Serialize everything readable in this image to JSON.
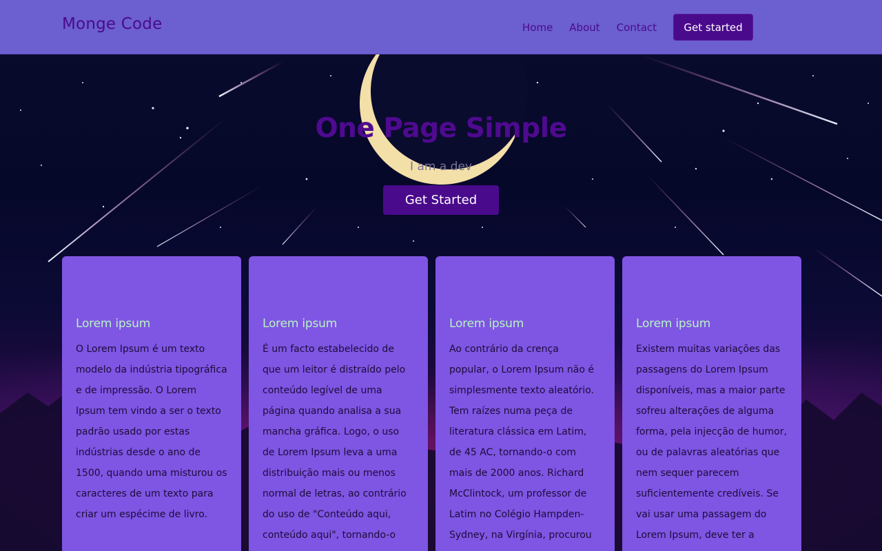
{
  "header": {
    "brand": "Monge Code",
    "nav": {
      "home": "Home",
      "about": "About",
      "contact": "Contact",
      "cta": "Get started"
    }
  },
  "hero": {
    "title": "One Page Simple",
    "subtitle": "I am a dev",
    "button": "Get Started"
  },
  "cards": [
    {
      "title": "Lorem ipsum",
      "text": "O Lorem Ipsum é um texto modelo da indústria tipográfica e de impressão. O Lorem Ipsum tem vindo a ser o texto padrão usado por estas indústrias desde o ano de 1500, quando uma misturou os caracteres de um texto para criar um espécime de livro."
    },
    {
      "title": "Lorem ipsum",
      "text": "É um facto estabelecido de que um leitor é distraído pelo conteúdo legível de uma página quando analisa a sua mancha gráfica. Logo, o uso de Lorem Ipsum leva a uma distribuição mais ou menos normal de letras, ao contrário do uso de \"Conteúdo aqui, conteúdo aqui\", tornando-o"
    },
    {
      "title": "Lorem ipsum",
      "text": "Ao contrário da crença popular, o Lorem Ipsum não é simplesmente texto aleatório. Tem raízes numa peça de literatura clássica em Latim, de 45 AC, tornando-o com mais de 2000 anos. Richard McClintock, um professor de Latim no Colégio Hampden-Sydney, na Virgínia, procurou"
    },
    {
      "title": "Lorem ipsum",
      "text": "Existem muitas variações das passagens do Lorem Ipsum disponíveis, mas a maior parte sofreu alterações de alguma forma, pela injecção de humor, ou de palavras aleatórias que nem sequer parecem suficientemente credíveis. Se vai usar uma passagem do Lorem Ipsum, deve ter a"
    }
  ],
  "colors": {
    "header_bg": "#6c5fd0",
    "brand_purple": "#4a0a8c",
    "card_bg": "#7f55e3",
    "card_title": "#b6f5c2"
  }
}
